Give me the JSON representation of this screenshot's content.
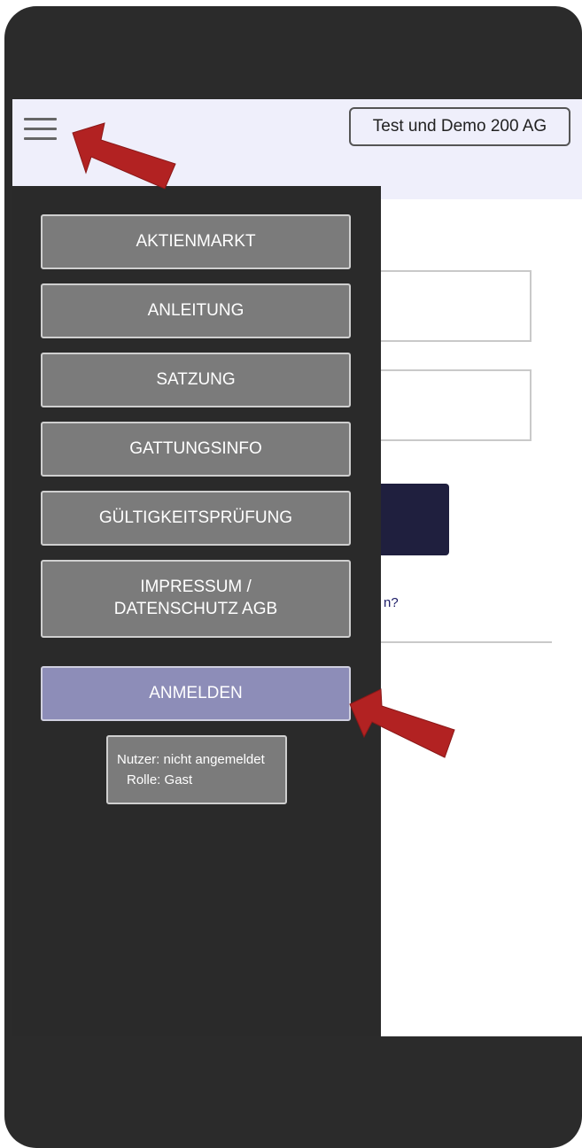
{
  "header": {
    "company_selector": "Test und Demo 200 AG"
  },
  "main": {
    "partial_link_text": "n?"
  },
  "menu": {
    "items": [
      {
        "label": "AKTIENMARKT"
      },
      {
        "label": "ANLEITUNG"
      },
      {
        "label": "SATZUNG"
      },
      {
        "label": "GATTUNGSINFO"
      },
      {
        "label": "GÜLTIGKEITSPRÜFUNG"
      },
      {
        "label": "IMPRESSUM / DATENSCHUTZ AGB"
      }
    ],
    "login_label": "ANMELDEN",
    "user_label": "Nutzer:",
    "user_value": "nicht angemeldet",
    "role_label": "Rolle:",
    "role_value": "Gast"
  },
  "colors": {
    "frame": "#2b2b2b",
    "topbar": "#efeffb",
    "drawer": "#2a2a2a",
    "menu_button": "#7b7b7b",
    "login_button": "#8d8db8",
    "annotation_arrow": "#b22222"
  },
  "icons": {
    "menu": "hamburger-icon"
  }
}
